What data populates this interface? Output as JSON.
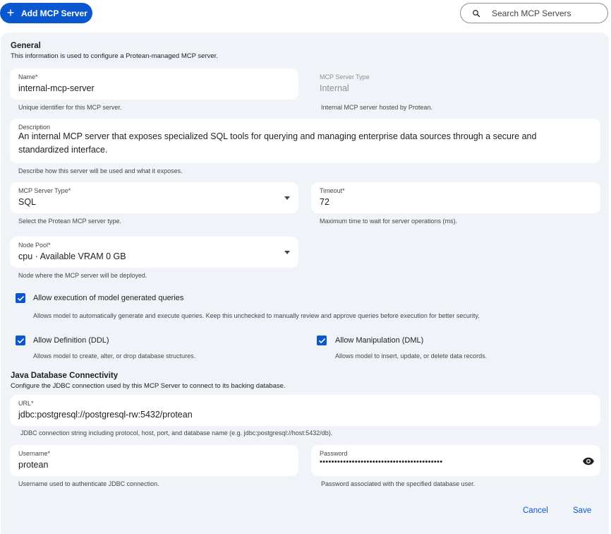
{
  "toolbar": {
    "add_label": "Add MCP Server",
    "search_placeholder": "Search MCP Servers"
  },
  "general": {
    "title": "General",
    "subtitle": "This information is used to configure a Protean-managed MCP server.",
    "name": {
      "label": "Name*",
      "value": "internal-mcp-server",
      "help": "Unique identifier for this MCP server."
    },
    "server_type_ro": {
      "label": "MCP Server Type",
      "value": "Internal",
      "help": "Internal MCP server hosted by Protean."
    },
    "description": {
      "label": "Description",
      "value": "An internal MCP server that exposes specialized SQL tools for querying and managing enterprise data sources through a secure and standardized interface.",
      "help": "Describe how this server will be used and what it exposes."
    },
    "mcp_type": {
      "label": "MCP Server Type*",
      "value": "SQL",
      "help": "Select the Protean MCP server type."
    },
    "timeout": {
      "label": "Timeout*",
      "value": "72",
      "help": "Maximum time to wait for server operations (ms)."
    },
    "node_pool": {
      "label": "Node Pool*",
      "value": "cpu · Available VRAM 0 GB",
      "help": "Node where the MCP server will be deployed."
    },
    "allow_exec": {
      "label": "Allow execution of model generated queries",
      "help": "Allows model to automatically generate and execute queries. Keep this unchecked to manually review and approve queries before execution for better security.",
      "checked": true
    },
    "allow_ddl": {
      "label": "Allow Definition (DDL)",
      "help": "Allows model to create, alter, or drop database structures.",
      "checked": true
    },
    "allow_dml": {
      "label": "Allow Manipulation (DML)",
      "help": "Allows model to insert, update, or delete data records.",
      "checked": true
    }
  },
  "jdbc": {
    "title": "Java Database Connectivity",
    "subtitle": "Configure the JDBC connection used by this MCP Server to connect to its backing database.",
    "url": {
      "label": "URL*",
      "value": "jdbc:postgresql://postgresql-rw:5432/protean",
      "help": "JDBC connection string including protocol, host, port, and database name (e.g. jdbc:postgresql://host:5432/db)."
    },
    "username": {
      "label": "Username*",
      "value": "protean",
      "help": "Username used to authenticate JDBC connection."
    },
    "password": {
      "label": "Password",
      "value": "••••••••••••••••••••••••••••••••••••••••••",
      "help": "Password associated with the specified database user."
    }
  },
  "actions": {
    "cancel": "Cancel",
    "save": "Save"
  },
  "colors": {
    "primary": "#0b57d0",
    "panel_bg": "#f0f4f9"
  }
}
